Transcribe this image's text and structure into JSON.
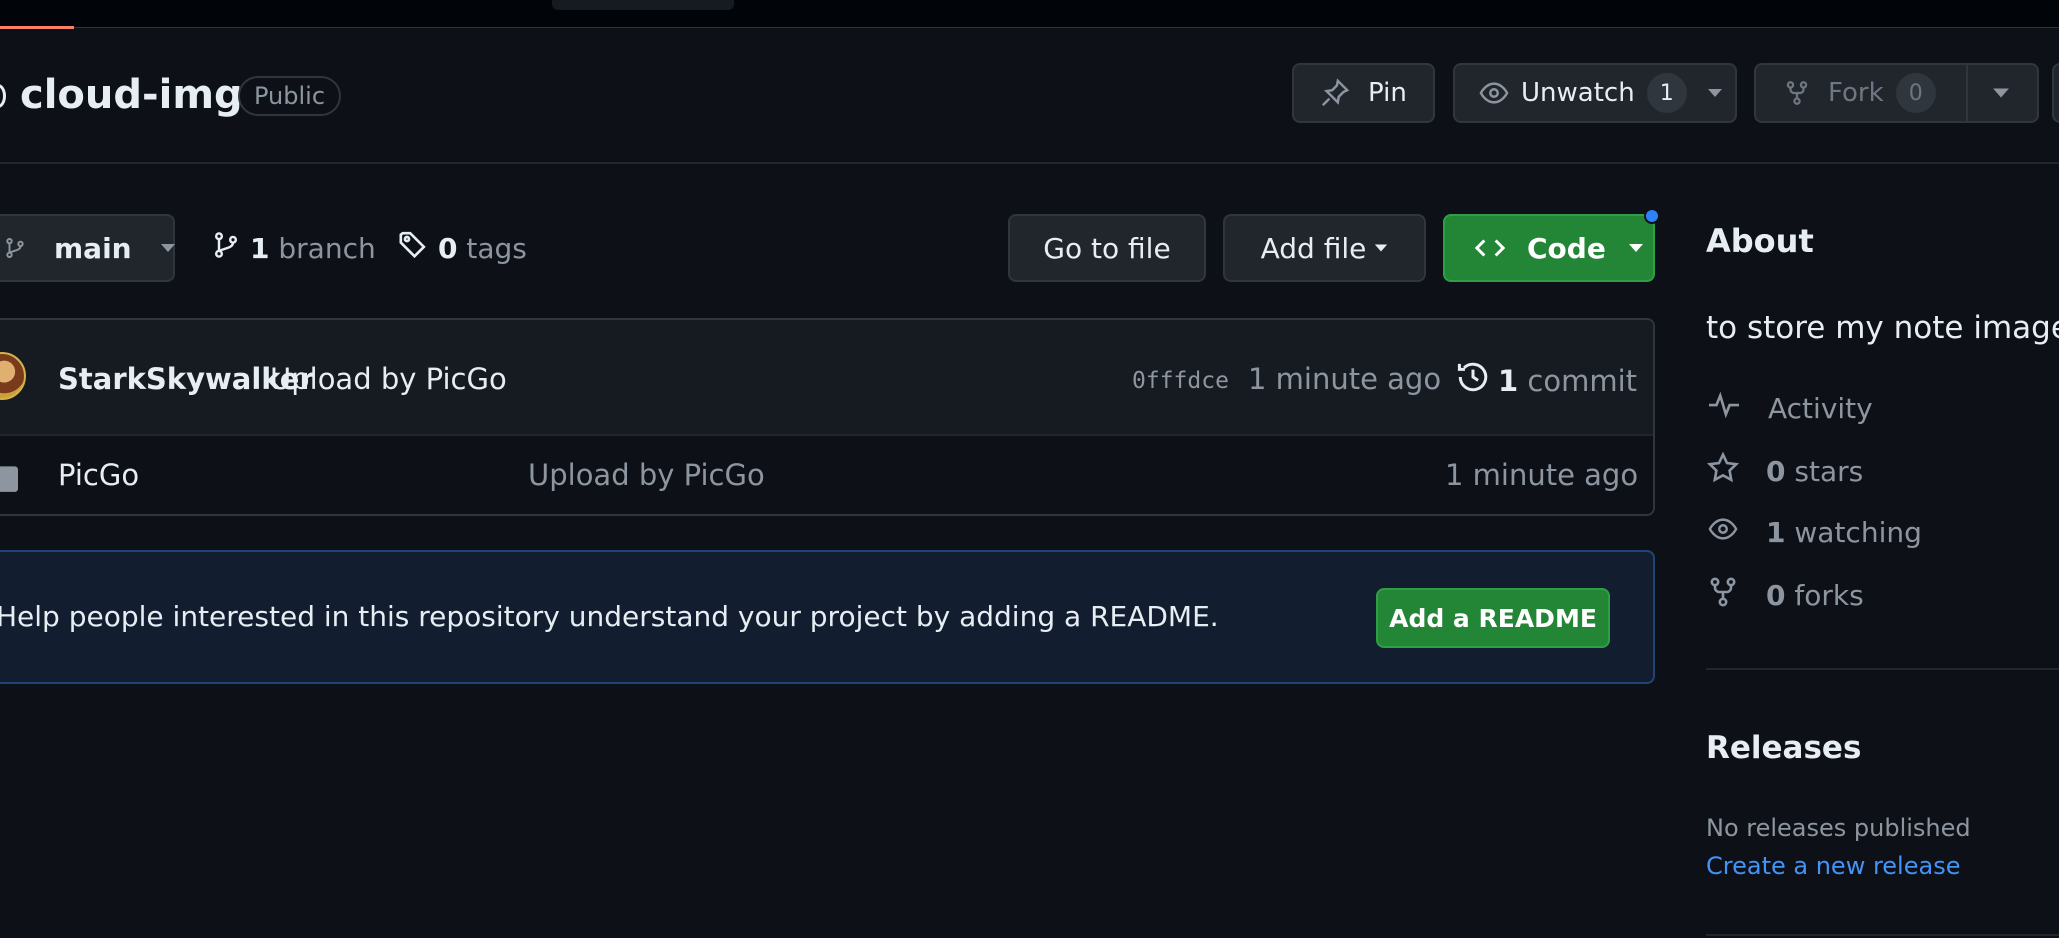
{
  "repo": {
    "name": "cloud-img",
    "visibility": "Public"
  },
  "actions": {
    "pin_label": "Pin",
    "unwatch_label": "Unwatch",
    "watch_count": "1",
    "fork_label": "Fork",
    "fork_count": "0"
  },
  "toolbar": {
    "branch_name": "main",
    "branch_count": "1",
    "branch_word": "branch",
    "tag_count": "0",
    "tag_word": "tags",
    "goto_file_label": "Go to file",
    "add_file_label": "Add file",
    "code_label": "Code"
  },
  "latest_commit": {
    "author": "StarkSkywalker",
    "message": "Upload by PicGo",
    "sha": "0fffdce",
    "time": "1 minute ago",
    "count": "1",
    "count_word": "commit"
  },
  "files": [
    {
      "name": "PicGo",
      "message": "Upload by PicGo",
      "time": "1 minute ago",
      "type": "folder"
    }
  ],
  "readme_banner": {
    "text": "Help people interested in this repository understand your project by adding a README.",
    "button_label": "Add a README"
  },
  "about": {
    "heading": "About",
    "description": "to store my note image",
    "activity_label": "Activity",
    "stars_count": "0",
    "stars_word": "stars",
    "watching_count": "1",
    "watching_word": "watching",
    "forks_count": "0",
    "forks_word": "forks"
  },
  "releases": {
    "heading": "Releases",
    "empty_text": "No releases published",
    "create_link": "Create a new release"
  },
  "colors": {
    "background": "#0d1117",
    "primary_button": "#238636",
    "link": "#4493f8",
    "muted_text": "#8d96a0"
  }
}
